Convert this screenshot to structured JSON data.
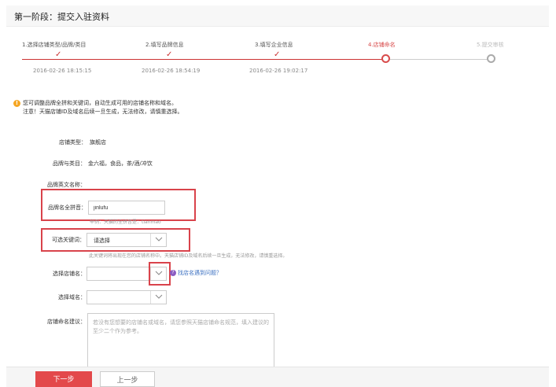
{
  "header": {
    "title": "第一阶段：提交入驻资料"
  },
  "steps": [
    {
      "label": "1.选择店铺类型/品牌/类目",
      "time": "2016-02-26 18:15:15",
      "state": "done"
    },
    {
      "label": "2.填写品牌信息",
      "time": "2016-02-26 18:54:19",
      "state": "done"
    },
    {
      "label": "3.填写企业信息",
      "time": "2016-02-26 19:02:17",
      "state": "done"
    },
    {
      "label": "4.店铺命名",
      "time": "",
      "state": "active"
    },
    {
      "label": "5.提交审核",
      "time": "",
      "state": "todo"
    }
  ],
  "notice": {
    "line1": "您可调整品牌全拼和关键词，自动生成可用的店铺名称和域名。",
    "line2": "注意！天猫店铺ID及域名后续一旦生成，无法修改，请慎重选择。"
  },
  "form": {
    "shop_type_label": "店铺类型：",
    "shop_type_value": "旗舰店",
    "brand_category_label": "品牌与类目：",
    "brand_category_value": "金六福，食品，茶/酒/冲饮",
    "brand_en_label": "品牌英文名称：",
    "brand_pinyin_label": "品牌名全拼音：",
    "brand_pinyin_value": "jinlufu",
    "brand_pinyin_hint": "举例：天猫的全拼音是：tianmao",
    "keyword_label": "可选关键词：",
    "keyword_value": "请选择",
    "keyword_hint": "此关键词将出现在您的店铺名称中。天猫店铺ID及域名后续一旦生成，无法修改，请慎重选择。",
    "shop_name_label": "选择店铺名：",
    "shop_name_value": "",
    "help_link": "找店名遇到问题？",
    "domain_label": "选择域名：",
    "domain_value": "",
    "suggest_label": "店铺命名建议：",
    "suggest_placeholder": "若没有您想要的店铺名或域名，请您参照天猫店铺命名规范，填入建议的至少二个作为参考。"
  },
  "buttons": {
    "next": "下一步",
    "prev": "上一步"
  },
  "colors": {
    "accent": "#d9434b",
    "primary_button": "#e3494b",
    "link": "#3a6fc1",
    "warning": "#f5a623"
  },
  "icons": {
    "check": "check-icon",
    "step_current": "step-circle-icon",
    "dropdown": "chevron-down-icon",
    "warning": "warning-icon",
    "help": "question-icon"
  }
}
